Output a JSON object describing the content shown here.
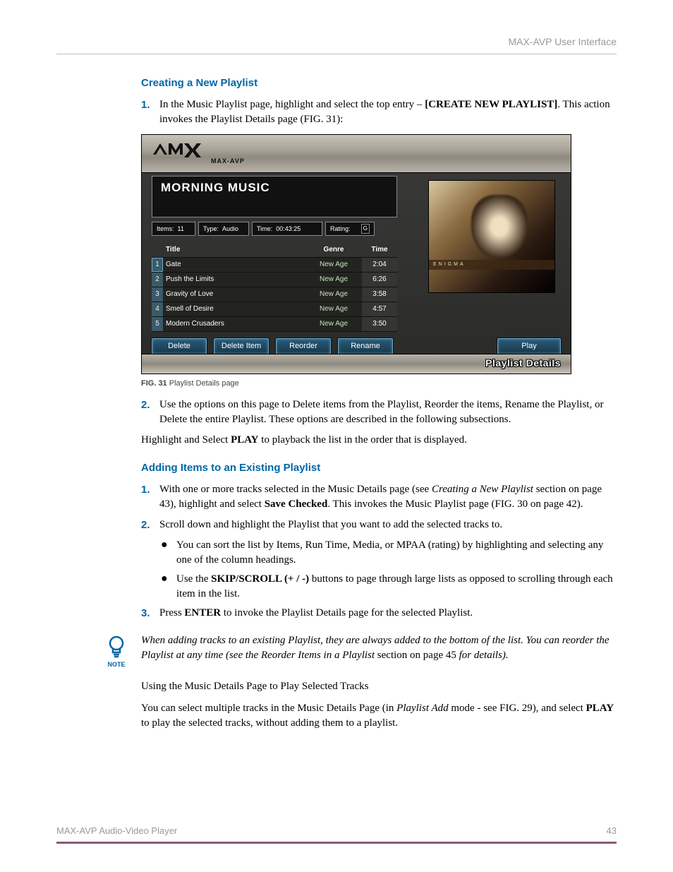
{
  "header": {
    "right": "MAX-AVP User Interface"
  },
  "section1": {
    "heading": "Creating a New Playlist",
    "step1": {
      "num": "1.",
      "pre": "In the Music Playlist page, highlight and select the top entry – ",
      "bold": "[CREATE NEW PLAYLIST]",
      "post": ". This action invokes the Playlist Details page (FIG. 31):"
    }
  },
  "screenshot": {
    "logo_sub": "MAX-AVP",
    "playlist_title": "MORNING MUSIC",
    "stats": {
      "items_label": "Items:",
      "items_value": "11",
      "type_label": "Type:",
      "type_value": "Audio",
      "time_label": "Time:",
      "time_value": "00:43:25",
      "rating_label": "Rating:",
      "rating_value": "G"
    },
    "columns": {
      "c1": "",
      "c2": "Title",
      "c3": "Genre",
      "c4": "Time"
    },
    "tracks": [
      {
        "n": "1",
        "title": "Gate",
        "genre": "New Age",
        "time": "2:04"
      },
      {
        "n": "2",
        "title": "Push the Limits",
        "genre": "New Age",
        "time": "6:26"
      },
      {
        "n": "3",
        "title": "Gravity of Love",
        "genre": "New Age",
        "time": "3:58"
      },
      {
        "n": "4",
        "title": "Smell of Desire",
        "genre": "New Age",
        "time": "4:57"
      },
      {
        "n": "5",
        "title": "Modern Crusaders",
        "genre": "New Age",
        "time": "3:50"
      }
    ],
    "album_strip": "ENIGMA",
    "buttons": {
      "delete": "Delete",
      "delete_item": "Delete Item",
      "reorder": "Reorder",
      "rename": "Rename",
      "play": "Play"
    },
    "breadcrumb": "Playlist Details"
  },
  "fig_caption": {
    "bold": "FIG. 31",
    "rest": " Playlist Details page"
  },
  "section1b": {
    "step2": {
      "num": "2.",
      "text": "Use the options on this page to Delete items from the Playlist, Reorder the items, Rename the Playlist, or Delete the entire Playlist. These options are described in the following subsections."
    },
    "line": {
      "pre": "Highlight and Select ",
      "bold": "PLAY",
      "post": " to playback the list in the order that is displayed."
    }
  },
  "section2": {
    "heading": "Adding Items to an Existing Playlist",
    "step1": {
      "num": "1.",
      "pre": "With one or more tracks selected in the Music Details page (see ",
      "it": "Creating a New Playlist",
      "mid": " section on page 43), highlight and select ",
      "bold": "Save Checked",
      "post": ". This invokes the Music Playlist page (FIG. 30 on page 42)."
    },
    "step2": {
      "num": "2.",
      "text": "Scroll down and highlight the Playlist that you want to add the selected tracks to."
    },
    "bullet1": "You can sort the list by Items, Run Time, Media, or MPAA (rating) by highlighting and selecting any one of the column headings.",
    "bullet2": {
      "pre": "Use the ",
      "bold": "SKIP/SCROLL (+ / -)",
      "post": " buttons to page through large lists as opposed to scrolling through each item in the list."
    },
    "step3": {
      "num": "3.",
      "pre": "Press ",
      "bold": "ENTER",
      "post": " to invoke the Playlist Details page for the selected Playlist."
    }
  },
  "note": {
    "label": "NOTE",
    "text1": "When adding tracks to an existing Playlist, they are always added to the bottom of the list. You can reorder the Playlist at any time (see the Reorder Items in a Playlist",
    "text2": " section on page 45 ",
    "text3": "for details)."
  },
  "section3": {
    "heading": "Using the Music Details Page to Play Selected Tracks",
    "line": {
      "pre": "You can select multiple tracks in the Music Details Page (in ",
      "it": "Playlist Add",
      "mid": " mode - see FIG. 29), and select ",
      "bold": "PLAY",
      "post": " to play the selected tracks, without adding them to a playlist."
    }
  },
  "footer": {
    "left": "MAX-AVP Audio-Video Player",
    "right": "43"
  }
}
